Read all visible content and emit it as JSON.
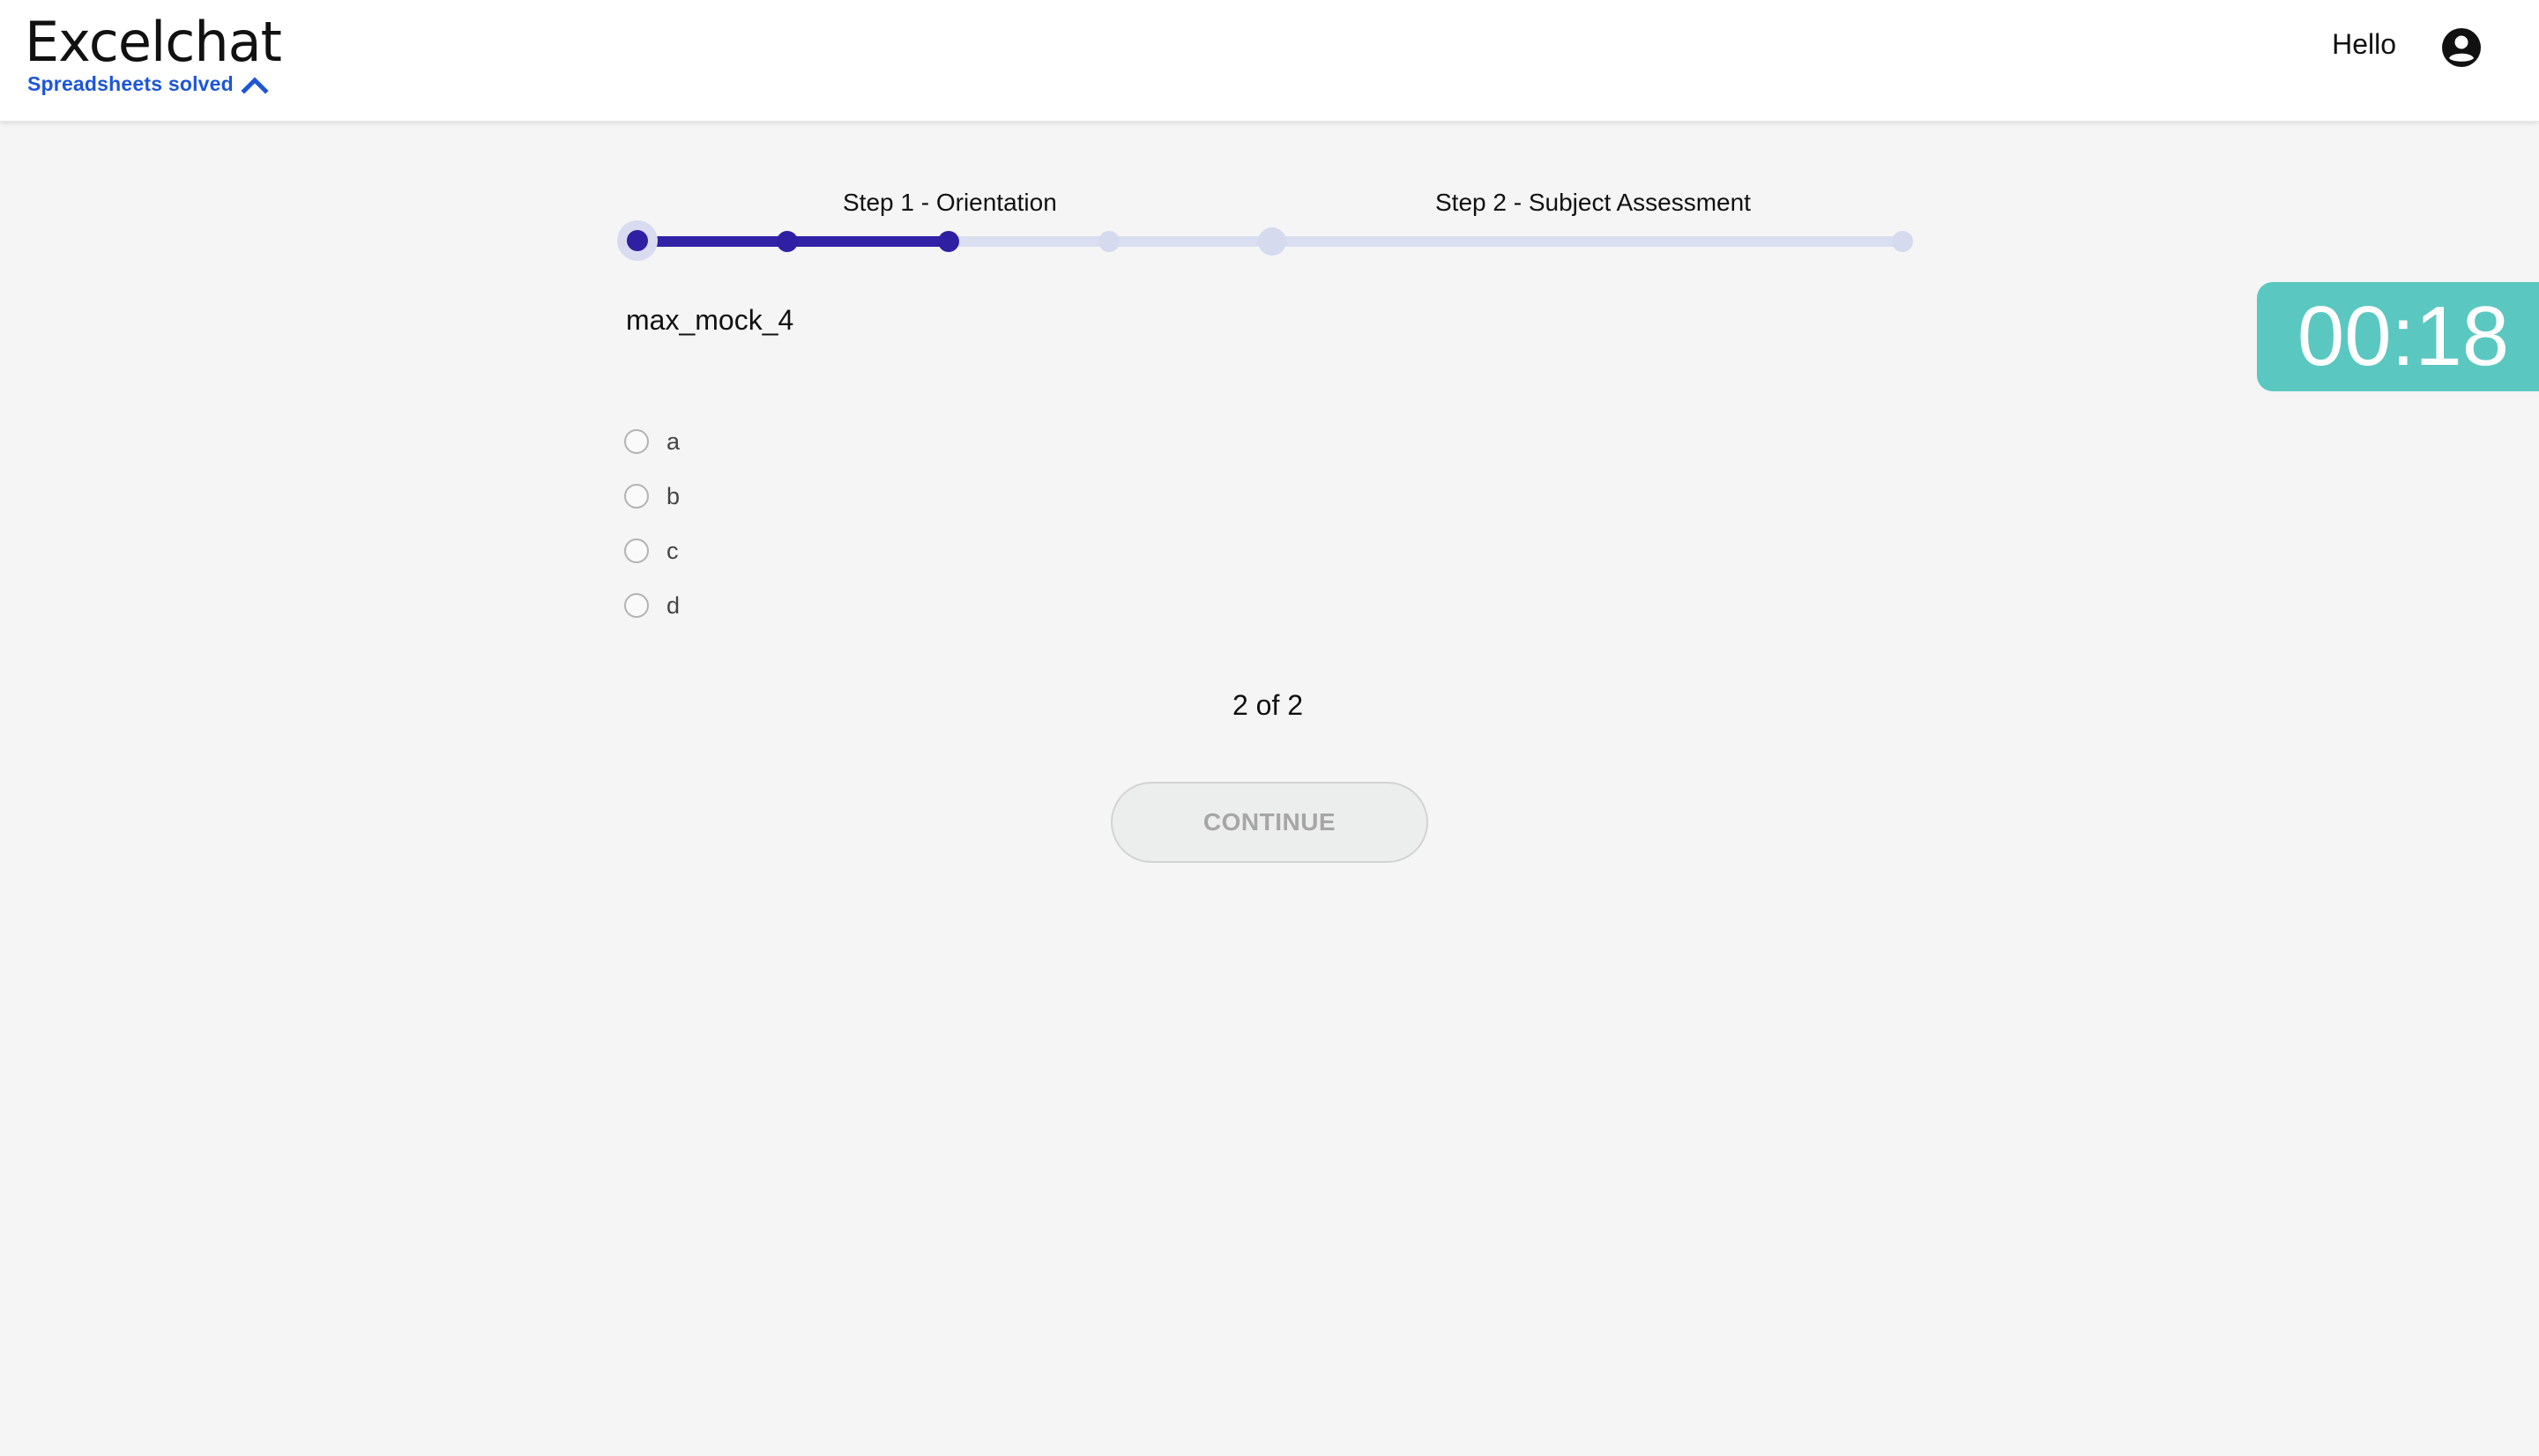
{
  "header": {
    "brand": "Excelchat",
    "tagline": "Spreadsheets solved",
    "greeting": "Hello",
    "account_icon": "account-circle-icon"
  },
  "stepper": {
    "steps": [
      {
        "label": "Step 1 - Orientation"
      },
      {
        "label": "Step 2 - Subject Assessment"
      }
    ],
    "colors": {
      "active": "#3122a6",
      "inactive": "#d9def0"
    }
  },
  "question": {
    "title": "max_mock_4",
    "options": [
      "a",
      "b",
      "c",
      "d"
    ],
    "progress": "2 of 2"
  },
  "actions": {
    "continue_label": "CONTINUE"
  },
  "timer": {
    "value": "00:18",
    "color": "#5ac8c0"
  }
}
